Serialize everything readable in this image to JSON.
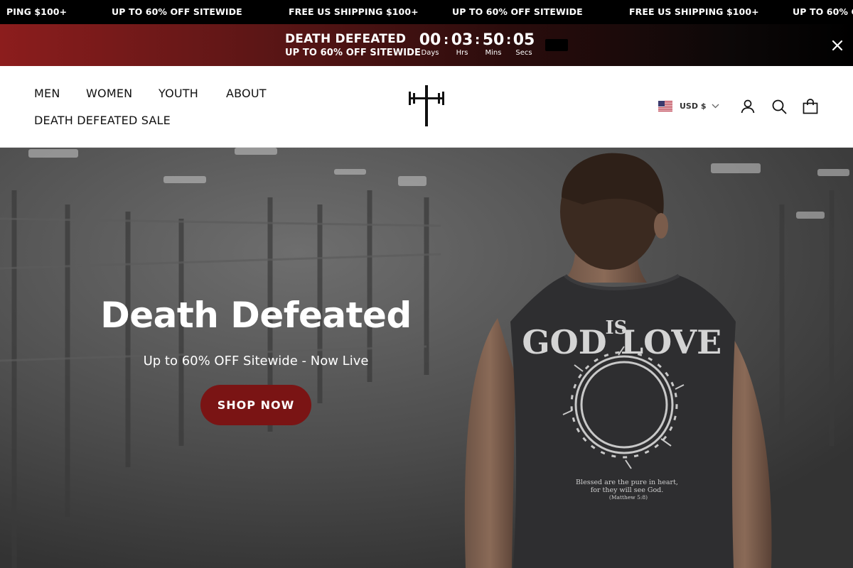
{
  "marquee": {
    "items": [
      "PING $100+",
      "UP TO 60% OFF SITEWIDE",
      "FREE US SHIPPING $100+",
      "UP TO 60% OFF SITEWIDE",
      "FREE US SHIPPING $100+",
      "UP TO 60% O"
    ]
  },
  "countdown": {
    "title": "DEATH DEFEATED",
    "subtitle": "UP TO 60% OFF SITEWIDE",
    "days": "00",
    "days_label": "Days",
    "hours": "03",
    "hours_label": "Hrs",
    "mins": "50",
    "mins_label": "Mins",
    "secs": "05",
    "secs_label": "Secs",
    "separator": ":"
  },
  "nav": {
    "men": "MEN",
    "women": "WOMEN",
    "youth": "YOUTH",
    "about": "ABOUT",
    "sale": "DEATH DEFEATED SALE"
  },
  "header": {
    "currency": "USD $"
  },
  "hero": {
    "title": "Death Defeated",
    "subtitle": "Up to 60% OFF Sitewide - Now Live",
    "cta": "SHOP NOW"
  },
  "shirt_print": {
    "line1": "GOD",
    "line2": "IS",
    "line3": "LOVE",
    "verse1": "Blessed are the pure in heart,",
    "verse2": "for they will see God.",
    "verse3": "(Matthew 5:8)"
  },
  "colors": {
    "accent": "#7a1414",
    "banner_start": "#8c1d1d",
    "marquee_bg": "#000000"
  }
}
